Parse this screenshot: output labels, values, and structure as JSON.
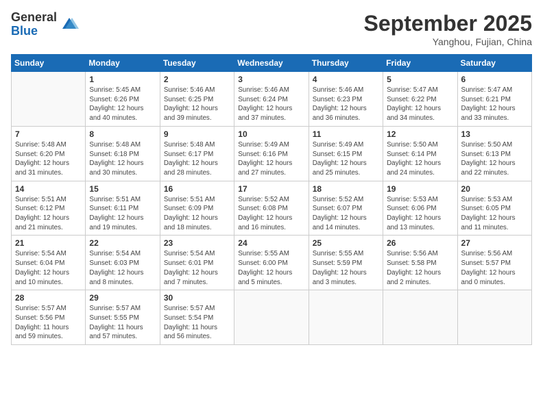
{
  "logo": {
    "general": "General",
    "blue": "Blue"
  },
  "title": "September 2025",
  "location": "Yanghou, Fujian, China",
  "weekdays": [
    "Sunday",
    "Monday",
    "Tuesday",
    "Wednesday",
    "Thursday",
    "Friday",
    "Saturday"
  ],
  "weeks": [
    [
      {
        "day": "",
        "info": ""
      },
      {
        "day": "1",
        "info": "Sunrise: 5:45 AM\nSunset: 6:26 PM\nDaylight: 12 hours\nand 40 minutes."
      },
      {
        "day": "2",
        "info": "Sunrise: 5:46 AM\nSunset: 6:25 PM\nDaylight: 12 hours\nand 39 minutes."
      },
      {
        "day": "3",
        "info": "Sunrise: 5:46 AM\nSunset: 6:24 PM\nDaylight: 12 hours\nand 37 minutes."
      },
      {
        "day": "4",
        "info": "Sunrise: 5:46 AM\nSunset: 6:23 PM\nDaylight: 12 hours\nand 36 minutes."
      },
      {
        "day": "5",
        "info": "Sunrise: 5:47 AM\nSunset: 6:22 PM\nDaylight: 12 hours\nand 34 minutes."
      },
      {
        "day": "6",
        "info": "Sunrise: 5:47 AM\nSunset: 6:21 PM\nDaylight: 12 hours\nand 33 minutes."
      }
    ],
    [
      {
        "day": "7",
        "info": "Sunrise: 5:48 AM\nSunset: 6:20 PM\nDaylight: 12 hours\nand 31 minutes."
      },
      {
        "day": "8",
        "info": "Sunrise: 5:48 AM\nSunset: 6:18 PM\nDaylight: 12 hours\nand 30 minutes."
      },
      {
        "day": "9",
        "info": "Sunrise: 5:48 AM\nSunset: 6:17 PM\nDaylight: 12 hours\nand 28 minutes."
      },
      {
        "day": "10",
        "info": "Sunrise: 5:49 AM\nSunset: 6:16 PM\nDaylight: 12 hours\nand 27 minutes."
      },
      {
        "day": "11",
        "info": "Sunrise: 5:49 AM\nSunset: 6:15 PM\nDaylight: 12 hours\nand 25 minutes."
      },
      {
        "day": "12",
        "info": "Sunrise: 5:50 AM\nSunset: 6:14 PM\nDaylight: 12 hours\nand 24 minutes."
      },
      {
        "day": "13",
        "info": "Sunrise: 5:50 AM\nSunset: 6:13 PM\nDaylight: 12 hours\nand 22 minutes."
      }
    ],
    [
      {
        "day": "14",
        "info": "Sunrise: 5:51 AM\nSunset: 6:12 PM\nDaylight: 12 hours\nand 21 minutes."
      },
      {
        "day": "15",
        "info": "Sunrise: 5:51 AM\nSunset: 6:11 PM\nDaylight: 12 hours\nand 19 minutes."
      },
      {
        "day": "16",
        "info": "Sunrise: 5:51 AM\nSunset: 6:09 PM\nDaylight: 12 hours\nand 18 minutes."
      },
      {
        "day": "17",
        "info": "Sunrise: 5:52 AM\nSunset: 6:08 PM\nDaylight: 12 hours\nand 16 minutes."
      },
      {
        "day": "18",
        "info": "Sunrise: 5:52 AM\nSunset: 6:07 PM\nDaylight: 12 hours\nand 14 minutes."
      },
      {
        "day": "19",
        "info": "Sunrise: 5:53 AM\nSunset: 6:06 PM\nDaylight: 12 hours\nand 13 minutes."
      },
      {
        "day": "20",
        "info": "Sunrise: 5:53 AM\nSunset: 6:05 PM\nDaylight: 12 hours\nand 11 minutes."
      }
    ],
    [
      {
        "day": "21",
        "info": "Sunrise: 5:54 AM\nSunset: 6:04 PM\nDaylight: 12 hours\nand 10 minutes."
      },
      {
        "day": "22",
        "info": "Sunrise: 5:54 AM\nSunset: 6:03 PM\nDaylight: 12 hours\nand 8 minutes."
      },
      {
        "day": "23",
        "info": "Sunrise: 5:54 AM\nSunset: 6:01 PM\nDaylight: 12 hours\nand 7 minutes."
      },
      {
        "day": "24",
        "info": "Sunrise: 5:55 AM\nSunset: 6:00 PM\nDaylight: 12 hours\nand 5 minutes."
      },
      {
        "day": "25",
        "info": "Sunrise: 5:55 AM\nSunset: 5:59 PM\nDaylight: 12 hours\nand 3 minutes."
      },
      {
        "day": "26",
        "info": "Sunrise: 5:56 AM\nSunset: 5:58 PM\nDaylight: 12 hours\nand 2 minutes."
      },
      {
        "day": "27",
        "info": "Sunrise: 5:56 AM\nSunset: 5:57 PM\nDaylight: 12 hours\nand 0 minutes."
      }
    ],
    [
      {
        "day": "28",
        "info": "Sunrise: 5:57 AM\nSunset: 5:56 PM\nDaylight: 11 hours\nand 59 minutes."
      },
      {
        "day": "29",
        "info": "Sunrise: 5:57 AM\nSunset: 5:55 PM\nDaylight: 11 hours\nand 57 minutes."
      },
      {
        "day": "30",
        "info": "Sunrise: 5:57 AM\nSunset: 5:54 PM\nDaylight: 11 hours\nand 56 minutes."
      },
      {
        "day": "",
        "info": ""
      },
      {
        "day": "",
        "info": ""
      },
      {
        "day": "",
        "info": ""
      },
      {
        "day": "",
        "info": ""
      }
    ]
  ]
}
